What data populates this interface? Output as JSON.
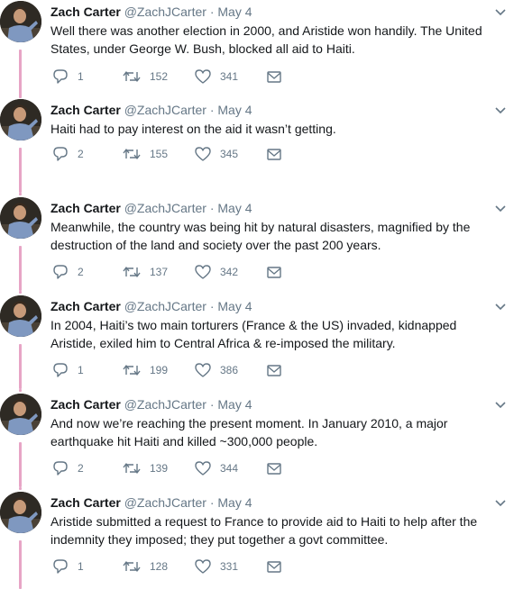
{
  "tweets": [
    {
      "name": "Zach Carter",
      "handle": "@ZachJCarter",
      "dot": "·",
      "time": "May 4",
      "text": "Well there was another election in 2000, and Aristide won handily. The United States, under George W. Bush, blocked all aid to Haiti.",
      "replies": "1",
      "retweets": "152",
      "likes": "341"
    },
    {
      "name": "Zach Carter",
      "handle": "@ZachJCarter",
      "dot": "·",
      "time": "May 4",
      "text": "Haiti had to pay interest on the aid it wasn’t getting.",
      "replies": "2",
      "retweets": "155",
      "likes": "345"
    },
    {
      "name": "Zach Carter",
      "handle": "@ZachJCarter",
      "dot": "·",
      "time": "May 4",
      "text": "Meanwhile, the country was being hit by natural disasters, magnified by the destruction of the land and society over the past 200 years.",
      "replies": "2",
      "retweets": "137",
      "likes": "342"
    },
    {
      "name": "Zach Carter",
      "handle": "@ZachJCarter",
      "dot": "·",
      "time": "May 4",
      "text": "In 2004, Haiti’s two main torturers (France & the US) invaded, kidnapped Aristide, exiled him to Central Africa & re-imposed the military.",
      "replies": "1",
      "retweets": "199",
      "likes": "386"
    },
    {
      "name": "Zach Carter",
      "handle": "@ZachJCarter",
      "dot": "·",
      "time": "May 4",
      "text": "And now we’re reaching the present moment. In January 2010, a major earthquake hit Haiti and killed ~300,000 people.",
      "replies": "2",
      "retweets": "139",
      "likes": "344"
    },
    {
      "name": "Zach Carter",
      "handle": "@ZachJCarter",
      "dot": "·",
      "time": "May 4",
      "text": "Aristide submitted a request to France to provide aid to Haiti to help after the indemnity they imposed; they put together a govt committee.",
      "replies": "1",
      "retweets": "128",
      "likes": "331"
    }
  ],
  "colors": {
    "thread_line": "#e7a5c6",
    "name": "#14171a",
    "meta": "#657786"
  },
  "icons": {
    "caret": "chevron-down-icon",
    "reply": "reply-icon",
    "retweet": "retweet-icon",
    "like": "heart-icon",
    "dm": "envelope-icon"
  }
}
